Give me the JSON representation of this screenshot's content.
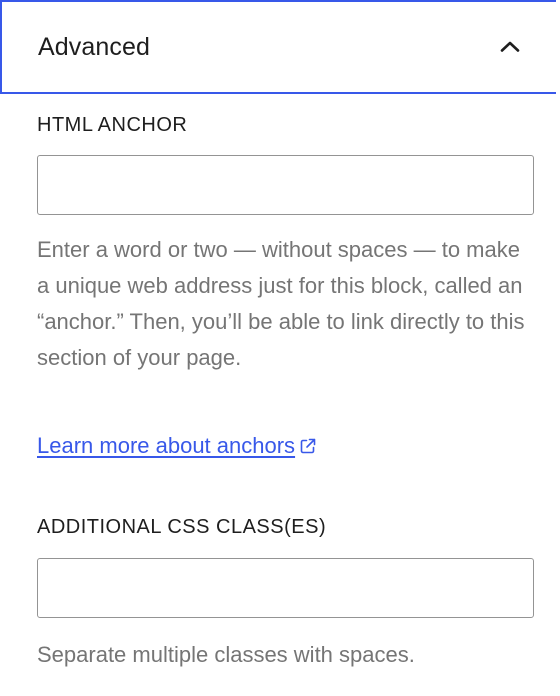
{
  "panel": {
    "title": "Advanced",
    "toggle_icon": "chevron-up-icon",
    "expanded": true
  },
  "html_anchor": {
    "label": "HTML ANCHOR",
    "value": "",
    "help": "Enter a word or two — without spaces — to make a unique web address just for this block, called an “anchor.” Then, you’ll be able to link directly to this section of your page.",
    "link_text": "Learn more about anchors",
    "link_icon": "external-link-icon"
  },
  "css_classes": {
    "label": "ADDITIONAL CSS CLASS(ES)",
    "value": "",
    "help": "Separate multiple classes with spaces."
  },
  "colors": {
    "accent": "#3858e9",
    "text": "#1e1e1e",
    "help_text": "#757575",
    "input_border": "#949494"
  }
}
